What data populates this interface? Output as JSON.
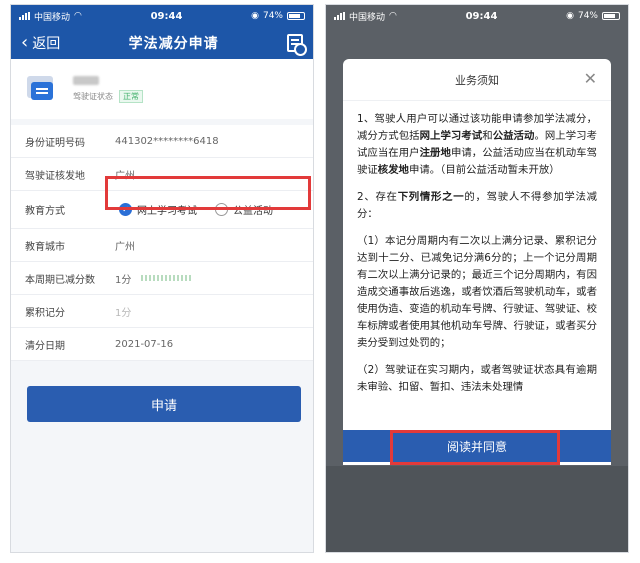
{
  "status_bar": {
    "carrier": "中国移动",
    "time": "09:44",
    "battery": "74%"
  },
  "left": {
    "nav": {
      "back_label": "返回",
      "title": "学法减分申请"
    },
    "profile": {
      "license_status_label": "驾驶证状态",
      "license_status_value": "正常"
    },
    "rows": {
      "id_number_label": "身份证明号码",
      "id_number_value": "441302********6418",
      "issue_place_label": "驾驶证核发地",
      "issue_place_value": "广州",
      "edu_method_label": "教育方式",
      "edu_option_online": "网上学习考试",
      "edu_option_public": "公益活动",
      "edu_option_selected": "online",
      "edu_city_label": "教育城市",
      "edu_city_value": "广州",
      "period_reduced_label": "本周期已减分数",
      "period_reduced_value": "1分",
      "total_points_label": "累积记分",
      "total_points_value": "1分",
      "clear_date_label": "清分日期",
      "clear_date_value": "2021-07-16"
    },
    "submit_label": "申请"
  },
  "right": {
    "modal": {
      "title": "业务须知",
      "p1_a": "1、驾驶人用户可以通过该功能申请参加学法减分，减分方式包括",
      "p1_b": "网上学习考试",
      "p1_c": "和",
      "p1_d": "公益活动",
      "p1_e": "。网上学习考试应当在用户",
      "p1_f": "注册地",
      "p1_g": "申请，公益活动应当在机动车驾驶证",
      "p1_h": "核发地",
      "p1_i": "申请。（目前公益活动暂未开放）",
      "p2_a": "2、存在",
      "p2_b": "下列情形之一",
      "p2_c": "的，驾驶人不得参加学法减分：",
      "p3": "（1）本记分周期内有二次以上满分记录、累积记分达到十二分、已减免记分满6分的；上一个记分周期有二次以上满分记录的；最近三个记分周期内，有因造成交通事故后逃逸，或者饮酒后驾驶机动车，或者使用伪造、变造的机动车号牌、行驶证、驾驶证、校车标牌或者使用其他机动车号牌、行驶证，或者买分卖分受到过处罚的；",
      "p4": "（2）驾驶证在实习期内，或者驾驶证状态具有逾期未审验、扣留、暂扣、违法未处理情",
      "agree_label": "阅读并同意"
    }
  },
  "colors": {
    "brand_blue": "#1d56a8",
    "button_blue": "#2a5db0",
    "highlight_red": "#e23a3a",
    "status_green": "#41b06b"
  }
}
